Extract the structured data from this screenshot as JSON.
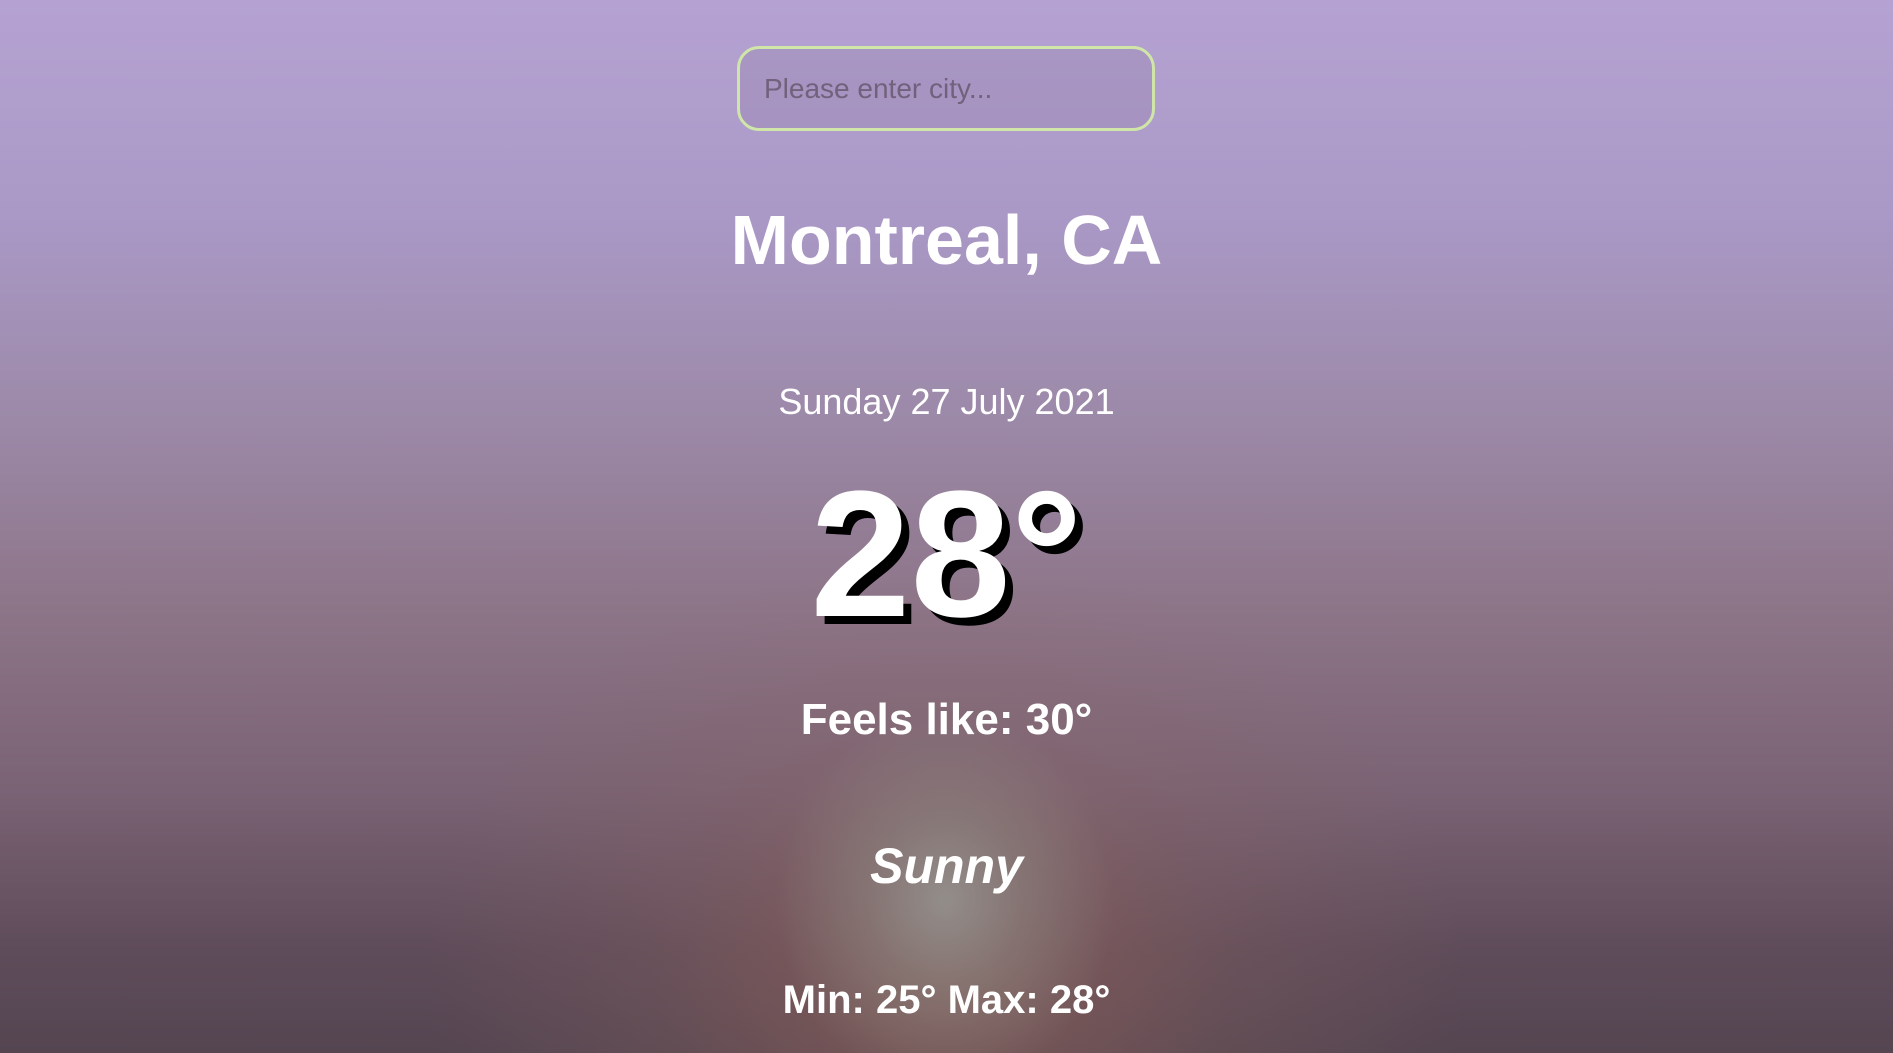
{
  "search": {
    "placeholder": "Please enter city...",
    "value": ""
  },
  "location": {
    "city": "Montreal, CA"
  },
  "date": "Sunday 27 July 2021",
  "weather": {
    "temperature": "28°",
    "feels_like": "Feels like: 30°",
    "condition": "Sunny",
    "min_max": "Min: 25° Max: 28°"
  },
  "colors": {
    "search_border": "#cfe6a8",
    "text": "#ffffff",
    "temp_shadow": "#000000",
    "bg_top": "#b5a2d2",
    "bg_bottom": "#544551"
  }
}
